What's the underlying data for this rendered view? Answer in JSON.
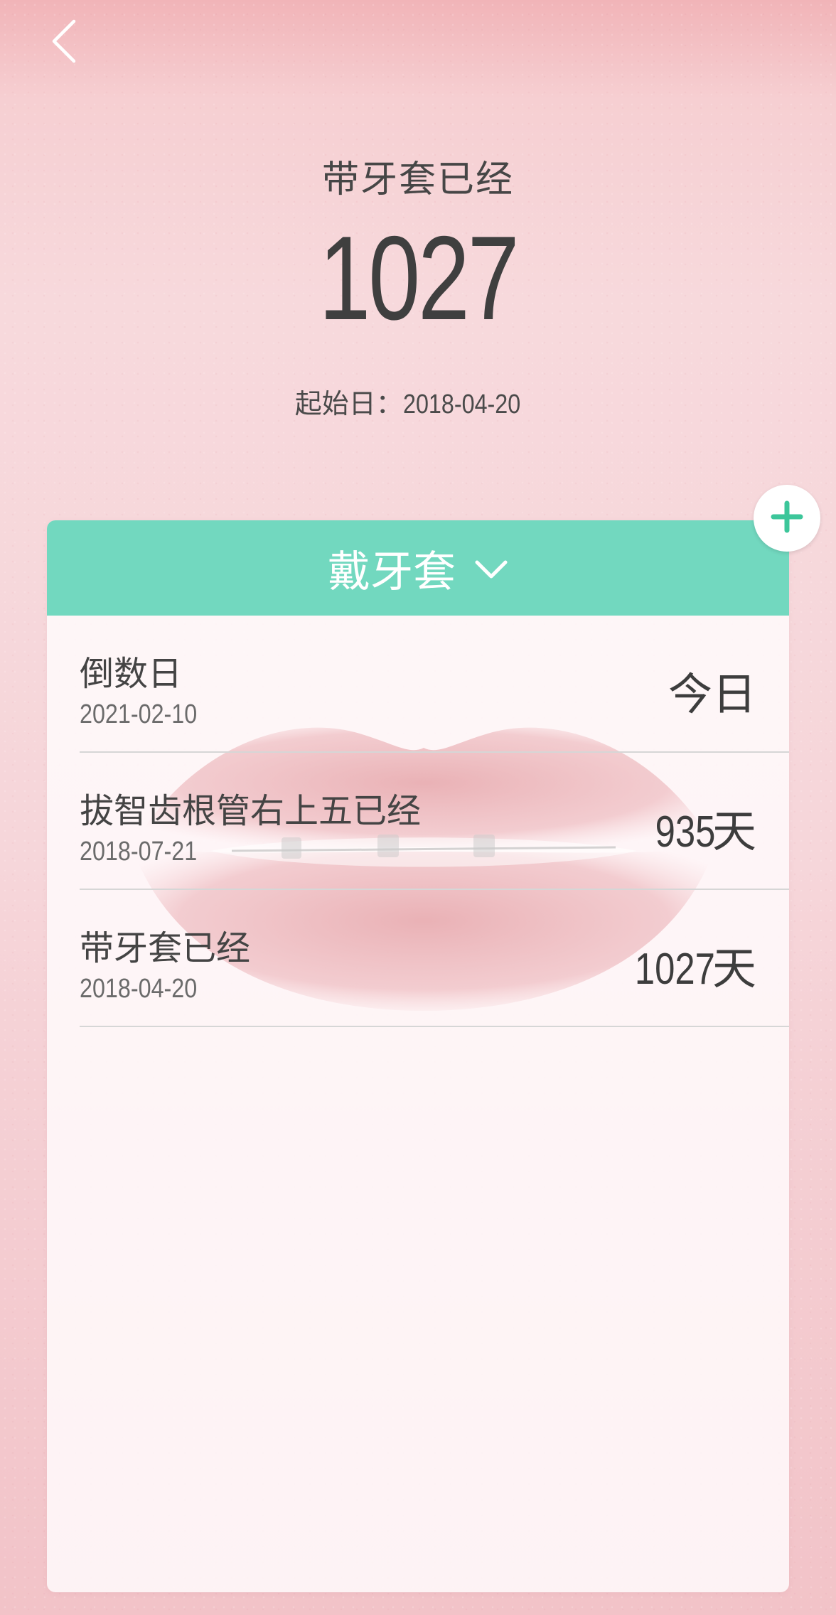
{
  "header": {
    "title": "带牙套已经",
    "count": "1027",
    "start_label": "起始日：",
    "start_date": "2018-04-20"
  },
  "category": {
    "name": "戴牙套"
  },
  "items": [
    {
      "name": "倒数日",
      "date": "2021-02-10",
      "value": "今日",
      "unit": ""
    },
    {
      "name": "拔智齿根管右上五已经",
      "date": "2018-07-21",
      "value": "935",
      "unit": "天"
    },
    {
      "name": "带牙套已经",
      "date": "2018-04-20",
      "value": "1027",
      "unit": "天"
    }
  ],
  "icons": {
    "back": "chevron-left-icon",
    "category_toggle": "chevron-down-icon",
    "add": "plus-icon"
  },
  "colors": {
    "accent": "#72d8bf",
    "add_icon": "#3cc69a",
    "background_top": "#f1b4b8",
    "text": "#444444"
  }
}
